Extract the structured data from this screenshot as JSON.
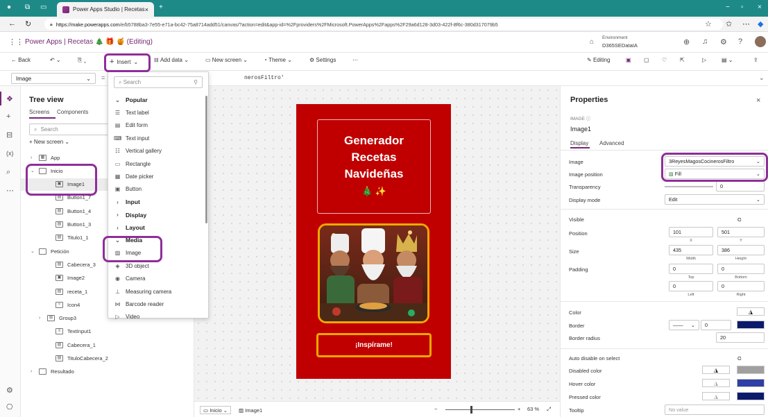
{
  "browser": {
    "tab_title": "Power Apps Studio | Recetas",
    "url_host": "https://make.powerapps.com",
    "url_path": "/e/b5788ba3-7e55-e71a-bc42-75a8714add51/canvas/?action=edit&app-id=%2Fproviders%2FMicrosoft.PowerApps%2Fapps%2F29a6d128-3d03-422f-8f6c-380d317079b5"
  },
  "app": {
    "title": "Power Apps | Recetas 🎄 🎁 🍯 (Editing)",
    "environment_label": "Environment",
    "environment_name": "D365SEDataIA"
  },
  "commands": {
    "back": "Back",
    "insert": "Insert",
    "add_data": "Add data",
    "new_screen": "New screen",
    "theme": "Theme",
    "settings": "Settings",
    "editing": "Editing"
  },
  "formula": {
    "property": "Image",
    "text": "nerosFiltro'"
  },
  "tree": {
    "title": "Tree view",
    "tab_screens": "Screens",
    "tab_components": "Components",
    "search_placeholder": "Search",
    "new_screen": "New screen",
    "items": [
      {
        "label": "App",
        "indent": 0,
        "chev": "›",
        "icon": "▦"
      },
      {
        "label": "Inicio",
        "indent": 0,
        "chev": "⌄",
        "icon": ""
      },
      {
        "label": "Image1",
        "indent": 2,
        "chev": "",
        "icon": "▣",
        "selected": true
      },
      {
        "label": "Button1_7",
        "indent": 2,
        "chev": "",
        "icon": "▤"
      },
      {
        "label": "Button1_4",
        "indent": 2,
        "chev": "",
        "icon": "▤"
      },
      {
        "label": "Button1_3",
        "indent": 2,
        "chev": "",
        "icon": "▤"
      },
      {
        "label": "Titulo1_1",
        "indent": 2,
        "chev": "",
        "icon": "▤"
      },
      {
        "label": "Petición",
        "indent": 0,
        "chev": "⌄",
        "icon": ""
      },
      {
        "label": "Cabecera_3",
        "indent": 2,
        "chev": "",
        "icon": "▤"
      },
      {
        "label": "Image2",
        "indent": 2,
        "chev": "",
        "icon": "▣"
      },
      {
        "label": "receta_1",
        "indent": 2,
        "chev": "",
        "icon": "▤"
      },
      {
        "label": "Icon4",
        "indent": 2,
        "chev": "",
        "icon": "✧"
      },
      {
        "label": "Group3",
        "indent": 1,
        "chev": "›",
        "icon": "⊞"
      },
      {
        "label": "TextInput1",
        "indent": 2,
        "chev": "",
        "icon": "≡"
      },
      {
        "label": "Cabecera_1",
        "indent": 2,
        "chev": "",
        "icon": "▤"
      },
      {
        "label": "TituloCabecera_2",
        "indent": 2,
        "chev": "",
        "icon": "▤"
      },
      {
        "label": "Resultado",
        "indent": 0,
        "chev": "›",
        "icon": ""
      }
    ]
  },
  "insert_menu": {
    "search_placeholder": "Search",
    "items": [
      {
        "label": "Popular",
        "type": "cat",
        "icon": "⌄"
      },
      {
        "label": "Text label",
        "type": "item",
        "icon": "☰"
      },
      {
        "label": "Edit form",
        "type": "item",
        "icon": "▤"
      },
      {
        "label": "Text input",
        "type": "item",
        "icon": "⌨"
      },
      {
        "label": "Vertical gallery",
        "type": "item",
        "icon": "☷"
      },
      {
        "label": "Rectangle",
        "type": "item",
        "icon": "▭"
      },
      {
        "label": "Date picker",
        "type": "item",
        "icon": "▦"
      },
      {
        "label": "Button",
        "type": "item",
        "icon": "▣"
      },
      {
        "label": "Input",
        "type": "cat",
        "icon": "›"
      },
      {
        "label": "Display",
        "type": "cat",
        "icon": "›"
      },
      {
        "label": "Layout",
        "type": "cat",
        "icon": "›"
      },
      {
        "label": "Media",
        "type": "cat",
        "icon": "⌄"
      },
      {
        "label": "Image",
        "type": "item",
        "icon": "▨"
      },
      {
        "label": "3D object",
        "type": "item",
        "icon": "◈"
      },
      {
        "label": "Camera",
        "type": "item",
        "icon": "◉"
      },
      {
        "label": "Measuring camera",
        "type": "item",
        "icon": "⊥"
      },
      {
        "label": "Barcode reader",
        "type": "item",
        "icon": "⋈"
      },
      {
        "label": "Video",
        "type": "item",
        "icon": "▷"
      }
    ]
  },
  "canvas": {
    "title_lines": [
      "Generador",
      "Recetas",
      "Navideñas"
    ],
    "title_emojis": "🎄 ✨",
    "button_label": "¡Inspírame!",
    "screen_crumb": "Inicio",
    "control_crumb": "Image1",
    "zoom": "63 %"
  },
  "properties": {
    "title": "Properties",
    "type_label": "IMAGE",
    "name": "Image1",
    "tab_display": "Display",
    "tab_advanced": "Advanced",
    "image_label": "Image",
    "image_value": "3ReyesMagosCocinerosFiltro",
    "image_position_label": "Image position",
    "image_position_value": "Fill",
    "transparency_label": "Transparency",
    "transparency_value": "0",
    "display_mode_label": "Display mode",
    "display_mode_value": "Edit",
    "visible_label": "Visible",
    "visible_value": "On",
    "position_label": "Position",
    "position_x": "101",
    "position_y": "501",
    "x_label": "X",
    "y_label": "Y",
    "size_label": "Size",
    "size_w": "435",
    "size_h": "386",
    "width_label": "Width",
    "height_label": "Height",
    "padding_label": "Padding",
    "pad_top": "0",
    "pad_bottom": "0",
    "pad_left": "0",
    "pad_right": "0",
    "top_label": "Top",
    "bottom_label": "Bottom",
    "left_label": "Left",
    "right_label": "Right",
    "color_label": "Color",
    "border_label": "Border",
    "border_value": "0",
    "border_radius_label": "Border radius",
    "border_radius_value": "20",
    "auto_disable_label": "Auto disable on select",
    "auto_disable_value": "On",
    "disabled_color_label": "Disabled color",
    "hover_color_label": "Hover color",
    "pressed_color_label": "Pressed color",
    "tooltip_label": "Tooltip",
    "tooltip_placeholder": "No value"
  },
  "colors": {
    "brand": "#742774",
    "screen_bg": "#c00000",
    "highlight_purple": "#8e2e99",
    "highlight_yellow": "#f0a800",
    "browser_teal": "#1e8a88"
  }
}
